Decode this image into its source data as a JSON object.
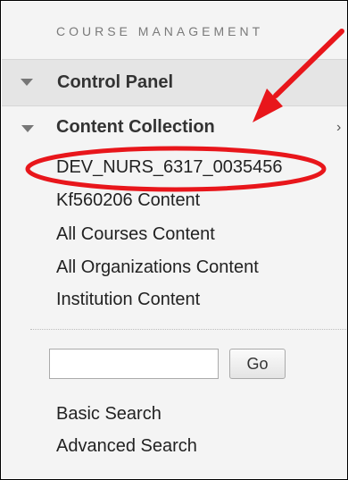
{
  "section": {
    "title": "COURSE MANAGEMENT"
  },
  "control_panel": {
    "label": "Control Panel"
  },
  "content_collection": {
    "label": "Content Collection",
    "chevron": "›",
    "items": [
      {
        "label": "DEV_NURS_6317_0035456"
      },
      {
        "label": "Kf560206 Content"
      },
      {
        "label": "All Courses Content"
      },
      {
        "label": "All Organizations Content"
      },
      {
        "label": "Institution Content"
      }
    ]
  },
  "search": {
    "value": "",
    "placeholder": "",
    "go_label": "Go",
    "links": [
      {
        "label": "Basic Search"
      },
      {
        "label": "Advanced Search"
      }
    ]
  },
  "annotations": {
    "arrow_color": "#e8161b",
    "highlight_color": "#e8161b"
  },
  "icons": {
    "control_panel": "triangle-down-icon",
    "content_collection": "triangle-down-icon",
    "chevron": "chevron-right-icon"
  }
}
